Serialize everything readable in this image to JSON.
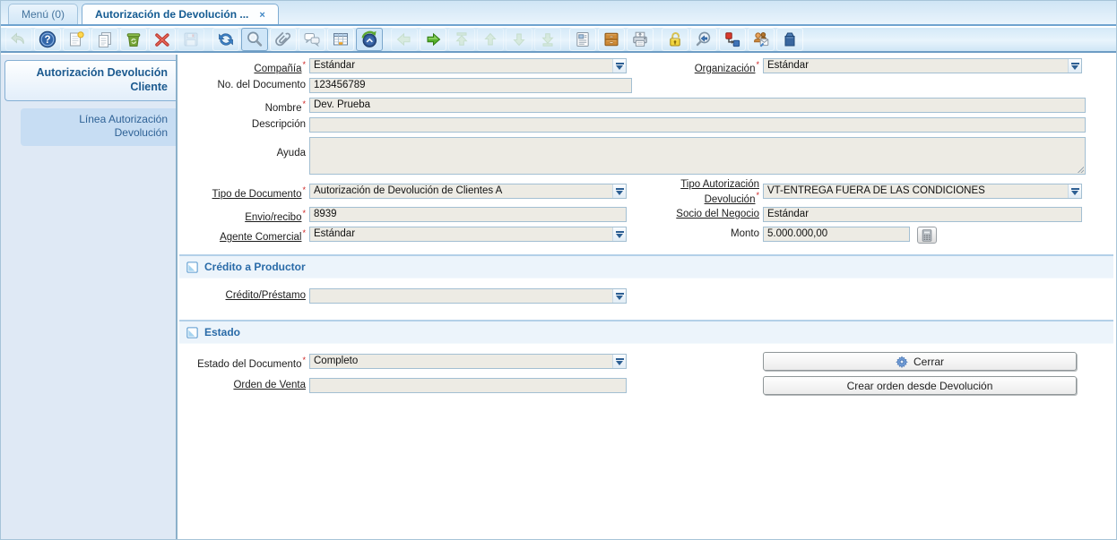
{
  "tabs": {
    "menu": "Menú (0)",
    "doc": "Autorización de Devolución ...",
    "close": "×"
  },
  "toolbar": {
    "groups": [
      [
        {
          "name": "undo",
          "symbol": "undo",
          "state": "disabled"
        },
        {
          "name": "help",
          "symbol": "help"
        },
        {
          "name": "new-record",
          "symbol": "new-record"
        },
        {
          "name": "copy-record",
          "symbol": "copy-record"
        },
        {
          "name": "delete-record",
          "symbol": "delete-record"
        },
        {
          "name": "delete-selection",
          "symbol": "delete-selection"
        },
        {
          "name": "save",
          "symbol": "save",
          "state": "disabled"
        }
      ],
      [
        {
          "name": "refresh",
          "symbol": "refresh"
        },
        {
          "name": "find",
          "symbol": "find",
          "state": "toggled"
        },
        {
          "name": "attachment",
          "symbol": "attachment"
        },
        {
          "name": "chat",
          "symbol": "chat"
        },
        {
          "name": "grid-toggle",
          "symbol": "grid-toggle"
        },
        {
          "name": "history",
          "symbol": "history",
          "state": "toggled"
        }
      ],
      [
        {
          "name": "parent-record",
          "symbol": "arrow-left",
          "state": "disabled"
        },
        {
          "name": "detail-record",
          "symbol": "arrow-right"
        },
        {
          "name": "first-record",
          "symbol": "first",
          "state": "disabled"
        },
        {
          "name": "previous-record",
          "symbol": "up",
          "state": "disabled"
        },
        {
          "name": "next-record",
          "symbol": "down",
          "state": "disabled"
        },
        {
          "name": "last-record",
          "symbol": "last",
          "state": "disabled"
        }
      ],
      [
        {
          "name": "report",
          "symbol": "report"
        },
        {
          "name": "archive",
          "symbol": "archive"
        },
        {
          "name": "print",
          "symbol": "print"
        }
      ],
      [
        {
          "name": "lock",
          "symbol": "lock"
        },
        {
          "name": "zoom-across",
          "symbol": "zoom-across"
        },
        {
          "name": "workflow",
          "symbol": "workflow"
        },
        {
          "name": "requests",
          "symbol": "requests"
        },
        {
          "name": "product-info",
          "symbol": "product-info"
        }
      ]
    ]
  },
  "sidebar": {
    "items": [
      {
        "label": "Autorización Devolución Cliente"
      },
      {
        "label": "Línea Autorización Devolución"
      }
    ]
  },
  "form": {
    "compania": {
      "label": "Compañía",
      "required": "*",
      "value": "Estándar"
    },
    "organizacion": {
      "label": "Organización",
      "required": "*",
      "value": "Estándar"
    },
    "no_documento": {
      "label": "No. del Documento",
      "value": "123456789"
    },
    "nombre": {
      "label": "Nombre",
      "required": "*",
      "value": "Dev. Prueba"
    },
    "descripcion": {
      "label": "Descripción",
      "value": ""
    },
    "ayuda": {
      "label": "Ayuda",
      "value": ""
    },
    "tipo_documento": {
      "label": "Tipo de Documento",
      "required": "*",
      "value": "Autorización de Devolución de Clientes A"
    },
    "tipo_autorizacion": {
      "label": "Tipo Autorización Devolución",
      "required": "*",
      "value": "VT-ENTREGA FUERA DE LAS CONDICIONES"
    },
    "envio_recibo": {
      "label": "Envio/recibo",
      "required": "*",
      "value": "8939"
    },
    "socio_negocio": {
      "label": "Socio del Negocio",
      "value": "Estándar"
    },
    "agente_comercial": {
      "label": "Agente Comercial",
      "required": "*",
      "value": "Estándar"
    },
    "monto": {
      "label": "Monto",
      "value": "5.000.000,00"
    },
    "credito_prestamo": {
      "label": "Crédito/Préstamo",
      "value": ""
    },
    "estado_documento": {
      "label": "Estado del Documento",
      "required": "*",
      "value": "Completo"
    },
    "orden_venta": {
      "label": "Orden de Venta",
      "value": ""
    }
  },
  "sections": {
    "credito": "Crédito a Productor",
    "estado": "Estado"
  },
  "buttons": {
    "cerrar": "Cerrar",
    "crear_orden": "Crear orden desde Devolución"
  }
}
